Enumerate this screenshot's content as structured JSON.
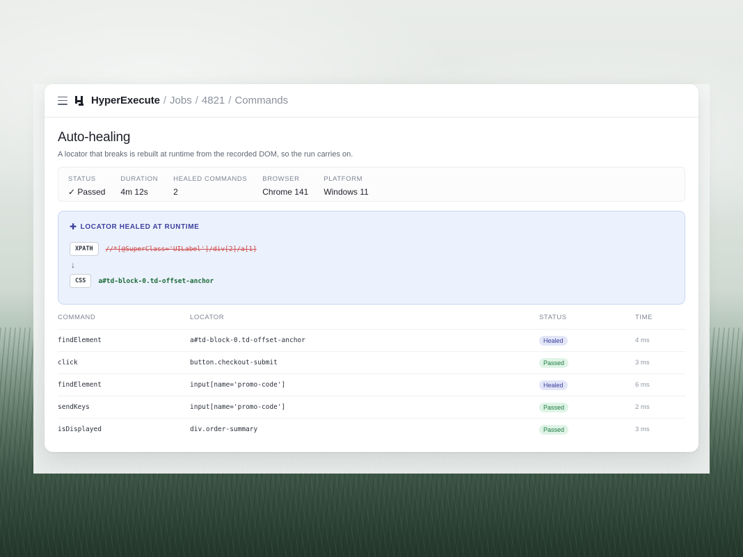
{
  "header": {
    "brand": "HyperExecute",
    "breadcrumb": [
      "Jobs",
      "4821",
      "Commands"
    ],
    "separator": "/"
  },
  "page": {
    "title": "Auto-healing",
    "subtitle": "A locator that breaks is rebuilt at runtime from the recorded DOM, so the run carries on."
  },
  "stats": [
    {
      "label": "STATUS",
      "value": "✓ Passed"
    },
    {
      "label": "DURATION",
      "value": "4m 12s"
    },
    {
      "label": "HEALED COMMANDS",
      "value": "2"
    },
    {
      "label": "BROWSER",
      "value": "Chrome 141"
    },
    {
      "label": "PLATFORM",
      "value": "Windows 11"
    }
  ],
  "heal": {
    "title": "LOCATOR HEALED AT RUNTIME",
    "plus_glyph": "✚",
    "old_type": "XPATH",
    "old_locator": "//*[@SuperClass='UILabel']/div[2]/a[1]",
    "arrow_glyph": "↓",
    "new_type": "CSS",
    "new_locator": "a#td-block-0.td-offset-anchor"
  },
  "table": {
    "columns": [
      "COMMAND",
      "LOCATOR",
      "STATUS",
      "TIME"
    ],
    "rows": [
      {
        "command": "findElement",
        "locator": "a#td-block-0.td-offset-anchor",
        "status": "Healed",
        "time": "4 ms"
      },
      {
        "command": "click",
        "locator": "button.checkout-submit",
        "status": "Passed",
        "time": "3 ms"
      },
      {
        "command": "findElement",
        "locator": "input[name='promo-code']",
        "status": "Healed",
        "time": "6 ms"
      },
      {
        "command": "sendKeys",
        "locator": "input[name='promo-code']",
        "status": "Passed",
        "time": "2 ms"
      },
      {
        "command": "isDisplayed",
        "locator": "div.order-summary",
        "status": "Passed",
        "time": "3 ms"
      }
    ]
  },
  "colors": {
    "healed_badge": "#e3e6f8",
    "passed_badge": "#dff4e6",
    "heal_box": "#ecf2fd",
    "old_locator": "#d04a4a",
    "new_locator": "#1d6b3a"
  }
}
